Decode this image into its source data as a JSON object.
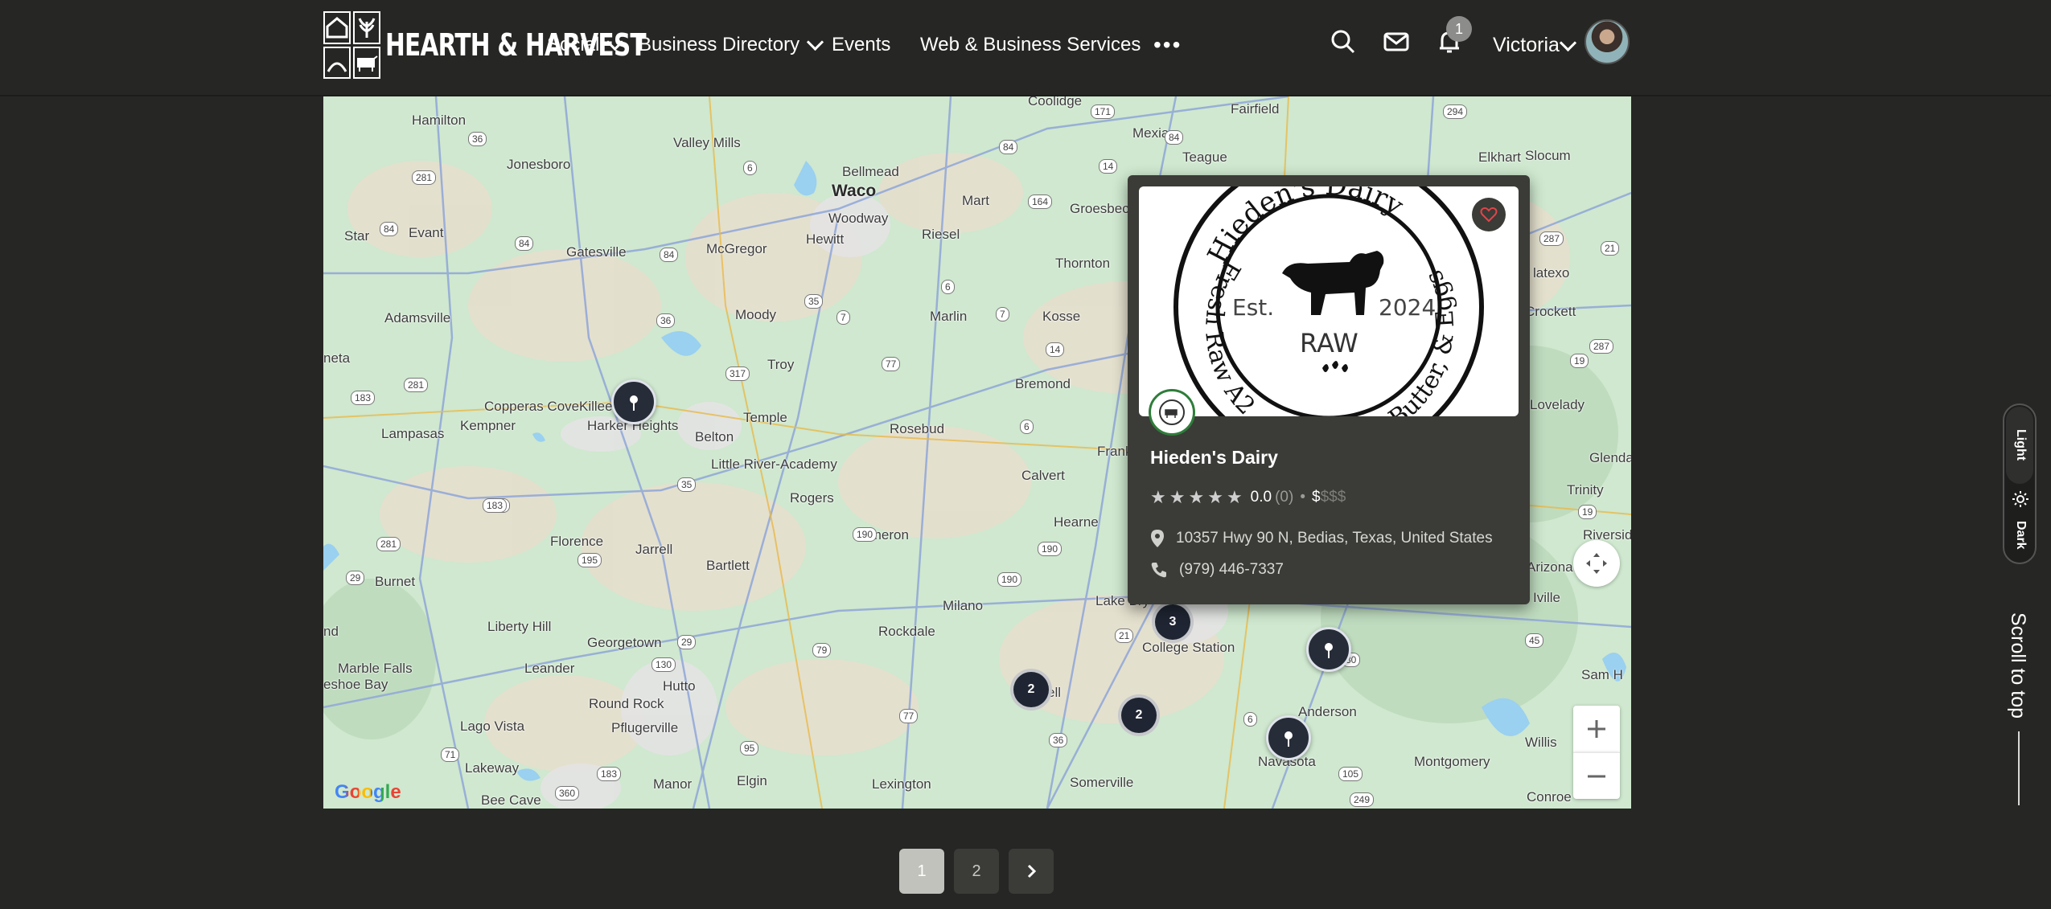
{
  "brand": {
    "logo_text": "HEARTH & HARVEST"
  },
  "nav": {
    "items": [
      {
        "label": "Social",
        "has_dropdown": true
      },
      {
        "label": "Business Directory",
        "has_dropdown": true
      },
      {
        "label": "Events",
        "has_dropdown": false
      },
      {
        "label": "Web & Business Services",
        "has_dropdown": false
      }
    ],
    "more_label": "•••"
  },
  "header": {
    "icons": [
      "search-icon",
      "mail-icon",
      "bell-icon"
    ],
    "notification_count": "1",
    "user_name": "Victoria"
  },
  "map": {
    "places": [
      {
        "name": "Hamilton"
      },
      {
        "name": "Jonesboro"
      },
      {
        "name": "Valley Mills"
      },
      {
        "name": "Bellmead"
      },
      {
        "name": "Waco"
      },
      {
        "name": "Mexia"
      },
      {
        "name": "Fairfield"
      },
      {
        "name": "Elkhart"
      },
      {
        "name": "Slocum"
      },
      {
        "name": "Mart"
      },
      {
        "name": "Groesbec"
      },
      {
        "name": "Teague"
      },
      {
        "name": "Woodway"
      },
      {
        "name": "Hewitt"
      },
      {
        "name": "Riesel"
      },
      {
        "name": "Star"
      },
      {
        "name": "Evant"
      },
      {
        "name": "Gatesville"
      },
      {
        "name": "McGregor"
      },
      {
        "name": "Thornton"
      },
      {
        "name": "Adamsville"
      },
      {
        "name": "Moody"
      },
      {
        "name": "Marlin"
      },
      {
        "name": "Kosse"
      },
      {
        "name": "Troy"
      },
      {
        "name": "Bremond"
      },
      {
        "name": "Copperas Cove"
      },
      {
        "name": "Killeen"
      },
      {
        "name": "Harker Heights"
      },
      {
        "name": "Kempner"
      },
      {
        "name": "Lampasas"
      },
      {
        "name": "Belton"
      },
      {
        "name": "Temple"
      },
      {
        "name": "Rosebud"
      },
      {
        "name": "Little River-Academy"
      },
      {
        "name": "Rogers"
      },
      {
        "name": "Calvert"
      },
      {
        "name": "Frank"
      },
      {
        "name": "Hearne"
      },
      {
        "name": "Florence"
      },
      {
        "name": "Jarrell"
      },
      {
        "name": "Cameron"
      },
      {
        "name": "Bartlett"
      },
      {
        "name": "Burnet"
      },
      {
        "name": "Milano"
      },
      {
        "name": "Lake Bry"
      },
      {
        "name": "College Station"
      },
      {
        "name": "Liberty Hill"
      },
      {
        "name": "Georgetown"
      },
      {
        "name": "Rockdale"
      },
      {
        "name": "Marble Falls"
      },
      {
        "name": "Leander"
      },
      {
        "name": "Hutto"
      },
      {
        "name": "Round Rock"
      },
      {
        "name": "Pflugerville"
      },
      {
        "name": "Anderson"
      },
      {
        "name": "Lago Vista"
      },
      {
        "name": "Navasota"
      },
      {
        "name": "Lexington"
      },
      {
        "name": "Lakeway"
      },
      {
        "name": "Bee Cave"
      },
      {
        "name": "Manor"
      },
      {
        "name": "Elgin"
      },
      {
        "name": "Somerville"
      },
      {
        "name": "Montgomery"
      },
      {
        "name": "Willis"
      },
      {
        "name": "Conroe"
      },
      {
        "name": "Crockett"
      },
      {
        "name": "Lovelady"
      },
      {
        "name": "Trinity"
      },
      {
        "name": "Riverside"
      },
      {
        "name": "Glenda"
      },
      {
        "name": "Sam H"
      },
      {
        "name": "Coolidge"
      },
      {
        "name": "latexo"
      },
      {
        "name": "Arizona"
      },
      {
        "name": "Iville"
      },
      {
        "name": "neta"
      },
      {
        "name": "nd"
      },
      {
        "name": "eshoe Bay"
      },
      {
        "name": "ell"
      }
    ],
    "road_shields": [
      "36",
      "281",
      "84",
      "84",
      "6",
      "84",
      "14",
      "171",
      "84",
      "84",
      "294",
      "164",
      "6",
      "7",
      "35",
      "7",
      "36",
      "317",
      "77",
      "14",
      "183",
      "281",
      "6",
      "35",
      "183",
      "190",
      "190",
      "281",
      "195",
      "190",
      "29",
      "130",
      "29",
      "79",
      "21",
      "77",
      "36",
      "95",
      "71",
      "183",
      "360",
      "105",
      "249",
      "6",
      "30",
      "45",
      "287",
      "21",
      "19",
      "287",
      "19",
      "183"
    ],
    "markers": [
      {
        "type": "pin"
      },
      {
        "type": "pin"
      },
      {
        "type": "pin"
      }
    ],
    "clusters": [
      {
        "count": "3"
      },
      {
        "count": "2"
      },
      {
        "count": "2"
      }
    ],
    "attribution": "Google"
  },
  "card": {
    "image_text": {
      "top": "Hieden's Dairy",
      "left": "Fresh Raw A2",
      "right": "Butter, & Eggs",
      "est": "Est.",
      "year": "2024",
      "raw": "RAW"
    },
    "title": "Hieden's Dairy",
    "rating": "0.0",
    "review_count": "(0)",
    "separator": "•",
    "price_active": "$",
    "price_inactive": "$$$",
    "address": "10357 Hwy 90 N, Bedias, Texas, United States",
    "phone": "(979) 446-7337"
  },
  "theme": {
    "light_label": "Light",
    "dark_label": "Dark"
  },
  "scroll_top_label": "Scroll to top",
  "pagination": {
    "pages": [
      "1",
      "2"
    ],
    "active": "1"
  }
}
